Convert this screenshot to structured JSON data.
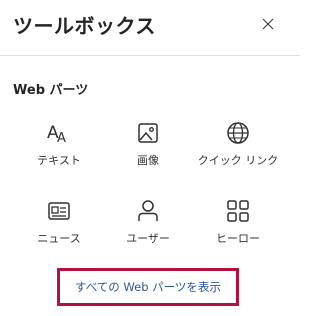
{
  "header": {
    "title": "ツールボックス",
    "close_icon": "close-icon"
  },
  "section": {
    "title": "Web パーツ"
  },
  "tiles": [
    {
      "label": "テキスト",
      "icon": "text-icon"
    },
    {
      "label": "画像",
      "icon": "image-icon"
    },
    {
      "label": "クイック リンク",
      "icon": "globe-icon"
    },
    {
      "label": "ニュース",
      "icon": "news-icon"
    },
    {
      "label": "ユーザー",
      "icon": "person-icon"
    },
    {
      "label": "ヒーロー",
      "icon": "hero-icon"
    }
  ],
  "show_all": {
    "label": "すべての Web パーツを表示"
  },
  "colors": {
    "text": "#242424",
    "link": "#2b579a",
    "highlight_border": "#b4103f",
    "divider": "#e1dfdd"
  }
}
